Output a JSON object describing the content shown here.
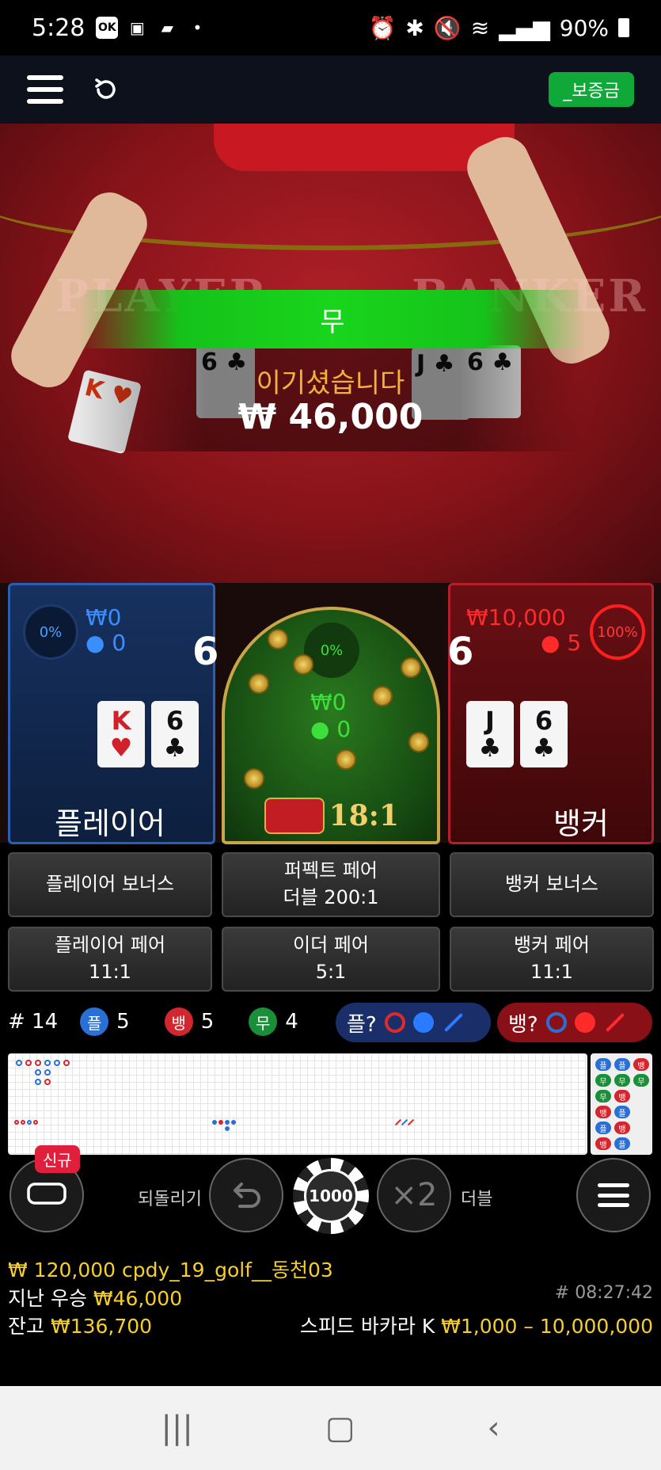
{
  "status_bar": {
    "time": "5:28",
    "left_icons": [
      "ok-icon",
      "image-icon",
      "chat-icon",
      "dot-icon"
    ],
    "battery": "90%",
    "right_icons": [
      "alarm-icon",
      "bluetooth-icon",
      "mute-icon",
      "wifi-icon",
      "signal-icon",
      "battery-icon"
    ]
  },
  "topbar": {
    "deposit_label": "_보증금"
  },
  "video": {
    "table_player_word": "PLAYER",
    "table_banker_word": "BANKER",
    "result_label": "무",
    "win_text": "이기셨습니다",
    "win_amount": "₩ 46,000"
  },
  "player": {
    "percent": "0%",
    "amount": "₩0",
    "users": "0",
    "score": "6",
    "cards": [
      {
        "rank": "K",
        "suit": "♥",
        "red": true
      },
      {
        "rank": "6",
        "suit": "♣",
        "red": false
      }
    ],
    "label": "플레이어"
  },
  "tie": {
    "percent": "0%",
    "amount": "₩0",
    "users": "0",
    "odds": "18:1"
  },
  "banker": {
    "percent": "100%",
    "amount": "₩10,000",
    "users": "5",
    "score": "6",
    "cards": [
      {
        "rank": "J",
        "suit": "♣",
        "red": false
      },
      {
        "rank": "6",
        "suit": "♣",
        "red": false
      }
    ],
    "label": "뱅커"
  },
  "side_bets": {
    "player_bonus": "플레이어 보너스",
    "perfect_pair": "퍼펙트 페어",
    "perfect_pair_odds": "더블 200:1",
    "banker_bonus": "뱅커 보너스",
    "player_pair": "플레이어 페어",
    "player_pair_odds": "11:1",
    "either_pair": "이더 페어",
    "either_pair_odds": "5:1",
    "banker_pair": "뱅커 페어",
    "banker_pair_odds": "11:1"
  },
  "stats": {
    "round": "# 14",
    "player_badge": "플",
    "player_count": "5",
    "banker_badge": "뱅",
    "banker_count": "5",
    "tie_badge": "무",
    "tie_count": "4",
    "player_ask": "플?",
    "banker_ask": "뱅?"
  },
  "road_side": [
    {
      "t": "플",
      "c": "#2a6fd6"
    },
    {
      "t": "플",
      "c": "#2a6fd6"
    },
    {
      "t": "뱅",
      "c": "#d3262e"
    },
    {
      "t": "무",
      "c": "#1a8f3a"
    },
    {
      "t": "무",
      "c": "#1a8f3a"
    },
    {
      "t": "무",
      "c": "#1a8f3a"
    },
    {
      "t": "무",
      "c": "#1a8f3a"
    },
    {
      "t": "뱅",
      "c": "#d3262e"
    },
    {
      "t": "",
      "c": "#efefef"
    },
    {
      "t": "뱅",
      "c": "#d3262e"
    },
    {
      "t": "플",
      "c": "#2a6fd6"
    },
    {
      "t": "",
      "c": "#efefef"
    },
    {
      "t": "플",
      "c": "#2a6fd6"
    },
    {
      "t": "뱅",
      "c": "#d3262e"
    },
    {
      "t": "",
      "c": "#efefef"
    },
    {
      "t": "뱅",
      "c": "#d3262e"
    },
    {
      "t": "플",
      "c": "#2a6fd6"
    },
    {
      "t": "",
      "c": "#efefef"
    },
    {
      "t": "플",
      "c": "#2a6fd6"
    },
    {
      "t": "플",
      "c": "#2a6fd6"
    },
    {
      "t": "",
      "c": "#efefef"
    }
  ],
  "controls": {
    "new_badge": "신규",
    "undo_label": "되돌리기",
    "chip_value": "1000",
    "double_symbol": "×2",
    "double_label": "더블"
  },
  "footer": {
    "user_line": "₩ 120,000 cpdy_19_golf__동천03",
    "last_win_label": "지난 우승",
    "last_win_amount": "₩46,000",
    "round_id": "# 08:27:42",
    "balance_label": "잔고",
    "balance_amount": "₩136,700",
    "table_name": "스피드 바카라 K",
    "limits": "₩1,000 – 10,000,000"
  },
  "colors": {
    "player_blue": "#2a6fd6",
    "banker_red": "#d3262e",
    "tie_green": "#1a8f3a",
    "accent_yellow": "#f6cf2e"
  }
}
